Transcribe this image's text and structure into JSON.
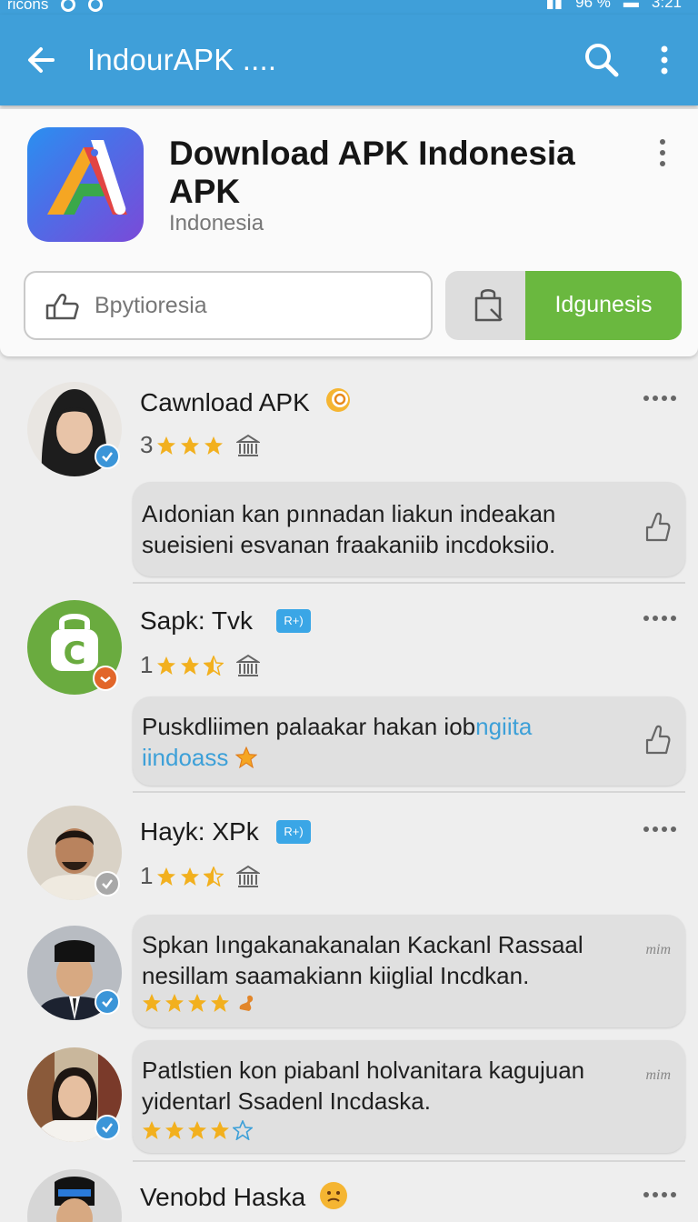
{
  "status_bar": {
    "left_text": "ricons",
    "battery": "96 %",
    "time": "3:21"
  },
  "app_bar": {
    "title": "IndourAPK ...."
  },
  "app": {
    "name": "Download APK Indonesia APK",
    "subtitle": "Indonesia",
    "search_placeholder": "Bpytioresia",
    "primary_button": "Idgunesis",
    "colors": {
      "app_bar": "#3f9fd9",
      "primary_button": "#6ab83f",
      "star": "#f2b01e"
    }
  },
  "feed": [
    {
      "name": "Cawnload APK",
      "rating_num": "3",
      "stars": 3,
      "comment": "Aıdonian kan pınnadan liakun indeakan sueisieni esvanan fraakaniib incdoksiio.",
      "badge": "blue"
    },
    {
      "name": "Sapk: Tvk",
      "tag": "R+)",
      "rating_num": "1",
      "stars": 2.5,
      "comment_line1": "Puskdliimen palaakar hakan iob",
      "comment_line1_blue": "ngiita",
      "comment_line2": "iindoass",
      "badge": "orange"
    },
    {
      "name": "Hayk: XPk",
      "tag": "R+)",
      "rating_num": "1",
      "stars": 2.5,
      "badge": "grey"
    },
    {
      "comment": "Spkan lıngakanakanalan Kackanl Rassaal nesillam saamakiann kiiglial Incdkan.",
      "mim": "mim",
      "stars": 4,
      "badge": "blue"
    },
    {
      "comment": "Patlstien kon piabanl holvanitara kagujuan yidentarl Ssadenl Incdaska.",
      "mim": "mim",
      "stars": 4.5,
      "badge": "blue"
    },
    {
      "name": "Venobd Haska"
    }
  ]
}
